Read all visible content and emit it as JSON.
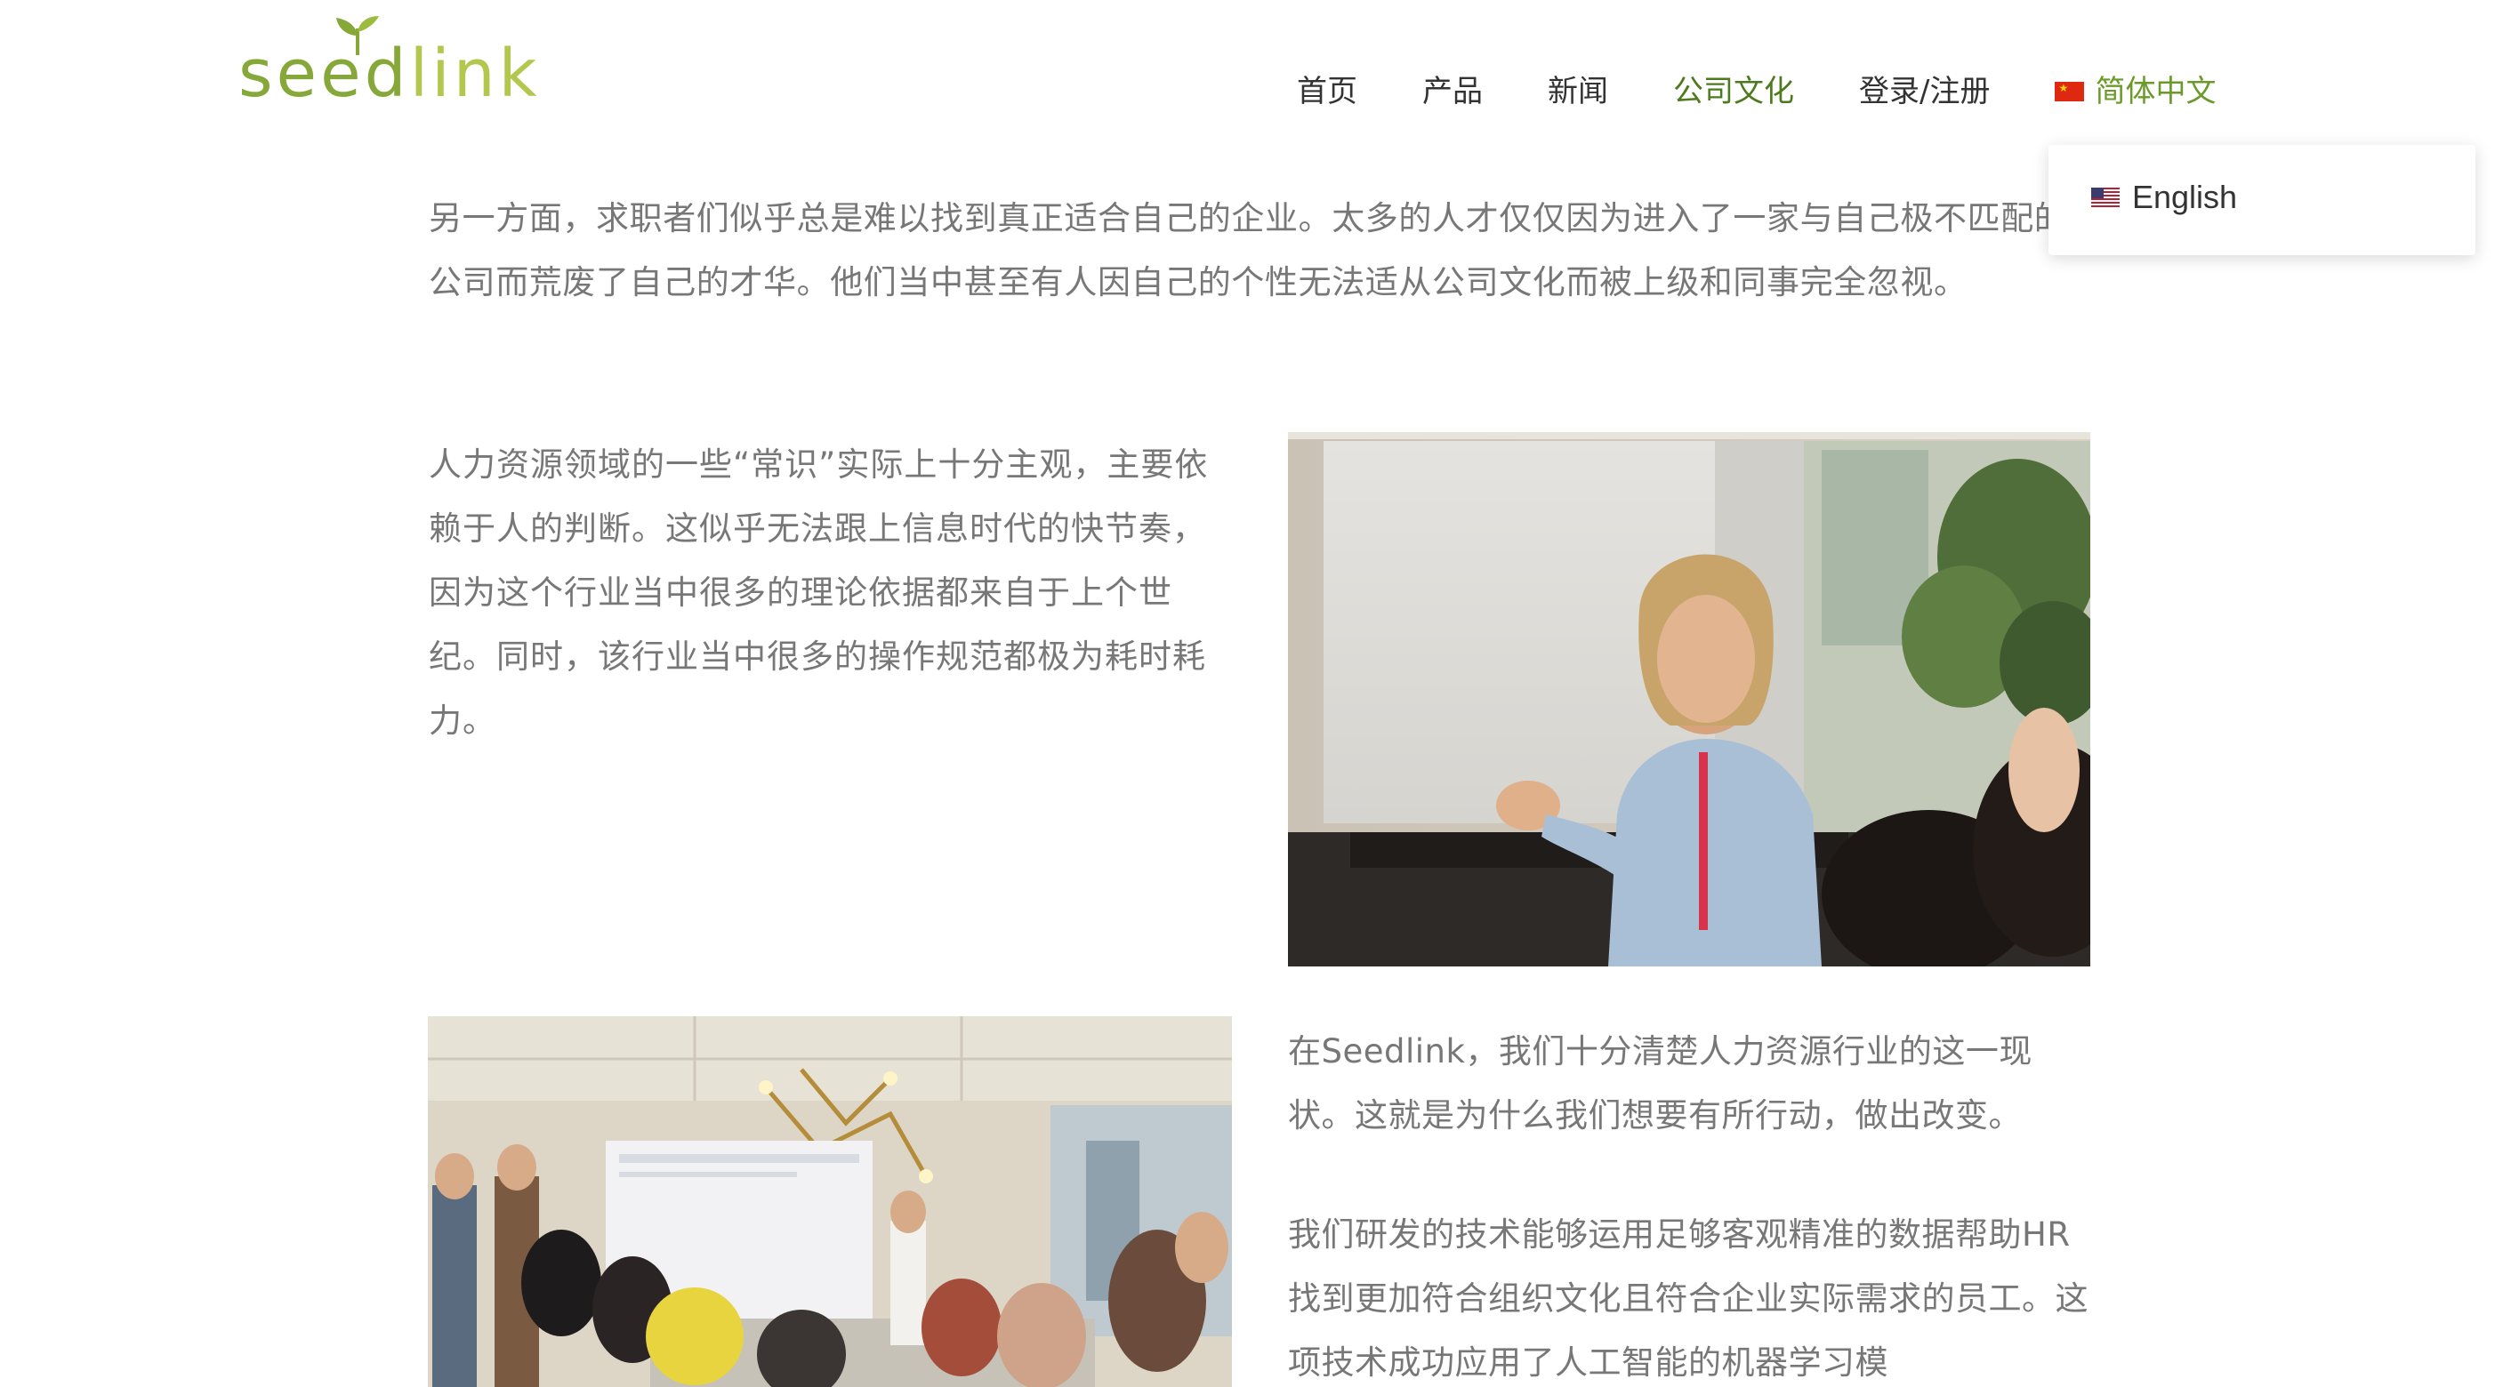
{
  "header": {
    "logo": {
      "part_1": "seed",
      "part_2": "link"
    },
    "nav": [
      {
        "label": "首页"
      },
      {
        "label": "产品"
      },
      {
        "label": "新闻"
      },
      {
        "label": "公司文化",
        "active": true
      },
      {
        "label": "登录/注册"
      }
    ],
    "language": {
      "current_label": "简体中文",
      "current_flag": "china-flag-icon",
      "dropdown": {
        "options": [
          {
            "label": "English",
            "flag": "us-flag-icon"
          }
        ]
      }
    }
  },
  "content": {
    "paragraph_1": "另一方面，求职者们似乎总是难以找到真正适合自己的企业。太多的人才仅仅因为进入了一家与自己极不匹配的公司而荒废了自己的才华。他们当中甚至有人因自己的个性无法适从公司文化而被上级和同事完全忽视。",
    "paragraph_2": "人力资源领域的一些“常识”实际上十分主观，主要依赖于人的判断。这似乎无法跟上信息时代的快节奏，因为这个行业当中很多的理论依据都来自于上个世纪。同时，该行业当中很多的操作规范都极为耗时耗力。",
    "paragraph_3": "在Seedlink，我们十分清楚人力资源行业的这一现状。这就是为什么我们想要有所行动，做出改变。",
    "paragraph_4": "我们研发的技术能够运用足够客观精准的数据帮助HR找到更加符合组织文化且符合企业实际需求的员工。这项技术成功应用了人工智能的机器学习模"
  },
  "colors": {
    "brand_green": "#86a839",
    "brand_light_green": "#b3c64d",
    "nav_active": "#4d7a1e",
    "language_label": "#6b9a2a",
    "body_text": "#777777",
    "nav_text": "#333333"
  }
}
